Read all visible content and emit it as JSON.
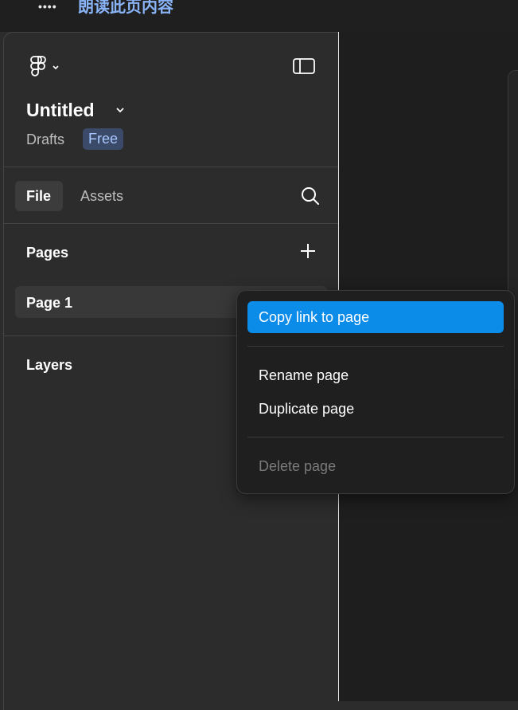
{
  "browser": {
    "menu_dots": "••••",
    "read_aloud": "朗读此页内容"
  },
  "sidebar": {
    "file_title": "Untitled",
    "location": "Drafts",
    "plan_badge": "Free",
    "tabs": [
      {
        "label": "File"
      },
      {
        "label": "Assets"
      }
    ],
    "pages_heading": "Pages",
    "pages": [
      {
        "label": "Page 1"
      }
    ],
    "layers_heading": "Layers"
  },
  "context_menu": {
    "items": [
      {
        "label": "Copy link to page",
        "state": "active"
      },
      {
        "label": "Rename page",
        "state": "normal"
      },
      {
        "label": "Duplicate page",
        "state": "normal"
      },
      {
        "label": "Delete page",
        "state": "disabled"
      }
    ]
  },
  "icons": {
    "logo": "figma-logo-icon",
    "panel": "sidebar-toggle-icon",
    "search": "search-icon",
    "add": "plus-icon",
    "chevron": "chevron-down-icon"
  },
  "colors": {
    "accent": "#0c8ce9",
    "panel_bg": "#2c2c2c",
    "menu_bg": "#1f1f1f",
    "badge_bg": "#3a4a68"
  }
}
